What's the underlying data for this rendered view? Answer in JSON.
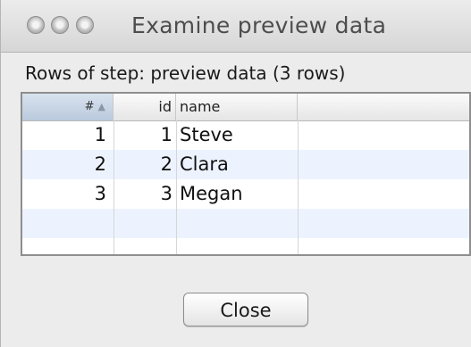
{
  "window": {
    "title": "Examine preview data"
  },
  "rows_label": "Rows of step: preview data (3 rows)",
  "table": {
    "columns": [
      "#",
      "id",
      "name"
    ],
    "sort_indicator": "▲",
    "rows": [
      {
        "num": "1",
        "id": "1",
        "name": "Steve"
      },
      {
        "num": "2",
        "id": "2",
        "name": "Clara"
      },
      {
        "num": "3",
        "id": "3",
        "name": "Megan"
      }
    ]
  },
  "buttons": {
    "close_label": "Close"
  }
}
